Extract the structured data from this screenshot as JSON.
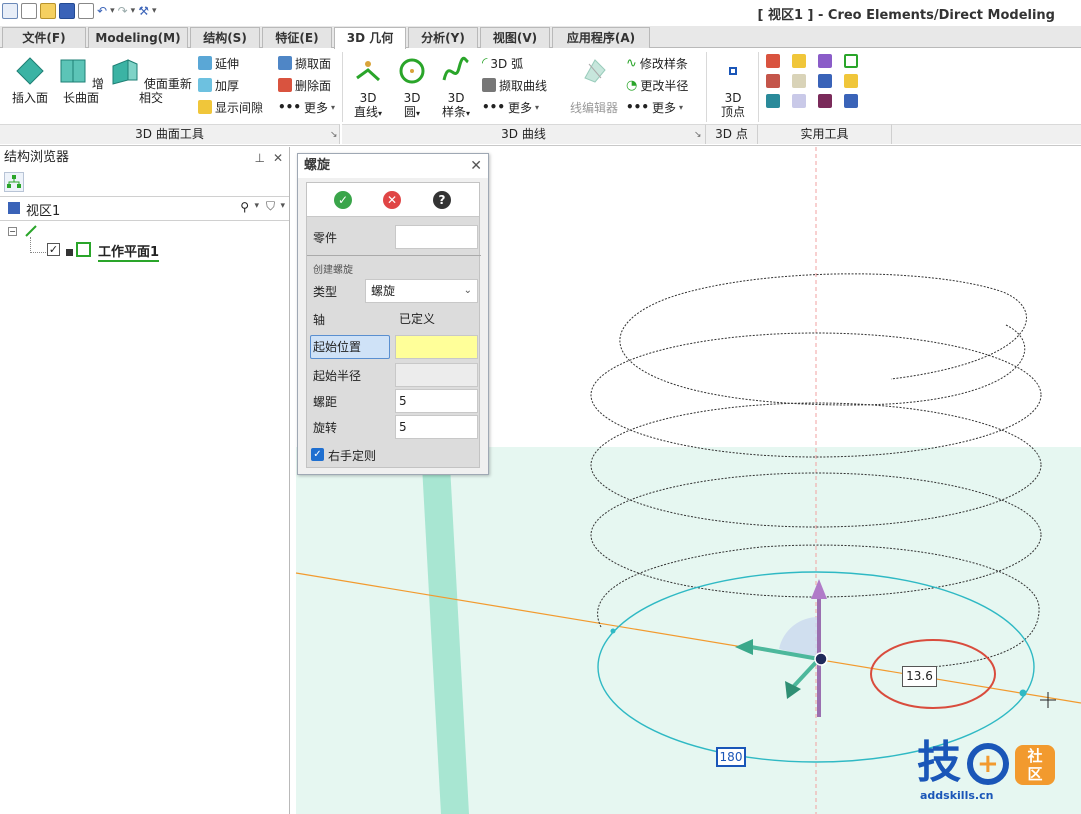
{
  "window": {
    "title": "[ 视区1 ] - Creo Elements/Direct Modeling"
  },
  "tabs": [
    {
      "label": "文件(F)"
    },
    {
      "label": "Modeling(M)"
    },
    {
      "label": "结构(S)"
    },
    {
      "label": "特征(E)"
    },
    {
      "label": "3D 几何"
    },
    {
      "label": "分析(Y)"
    },
    {
      "label": "视图(V)"
    },
    {
      "label": "应用程序(A)"
    }
  ],
  "ribbon": {
    "surface_tools": {
      "label": "3D 曲面工具",
      "insert_face": "插入面",
      "grow_surface": "增长曲面",
      "reintersect": "使面重新相交",
      "extend": "延伸",
      "thicken": "加厚",
      "show_gap": "显示间隙",
      "pick_face": "撷取面",
      "delete_face": "删除面",
      "more": "更多"
    },
    "curves": {
      "label": "3D 曲线",
      "line_top": "3D",
      "line_bottom": "直线",
      "circle_top": "3D",
      "circle_bottom": "圆",
      "spline_top": "3D",
      "spline_bottom": "样条",
      "arc": "3D 弧",
      "pick_curve": "撷取曲线",
      "more": "更多",
      "wire_editor": "线编辑器",
      "modify_spline": "修改样条",
      "change_radius": "更改半径",
      "more2": "更多"
    },
    "points": {
      "label": "3D 点",
      "vertex_top": "3D",
      "vertex_bottom": "顶点"
    },
    "utilities": {
      "label": "实用工具"
    }
  },
  "browser": {
    "title": "结构浏览器",
    "view_name": "视区1",
    "tree_item": "工作平面1"
  },
  "dialog": {
    "title": "螺旋",
    "part_label": "零件",
    "part_value": "",
    "section_label": "创建螺旋",
    "type_label": "类型",
    "type_value": "螺旋",
    "axis_label": "轴",
    "axis_value": "已定义",
    "start_pos_label": "起始位置",
    "start_pos_value": "",
    "start_radius_label": "起始半径",
    "start_radius_value": "",
    "pitch_label": "螺距",
    "pitch_value": "5",
    "turns_label": "旋转",
    "turns_value": "5",
    "right_hand_label": "右手定则",
    "right_hand_checked": true
  },
  "viewport": {
    "radius_readout": "13.6",
    "angle_readout": "180"
  },
  "watermark": {
    "text": "addskills.cn",
    "logo": "技社区"
  },
  "colors": {
    "accent_blue": "#1a56b8",
    "surface_green": "#b8ebd8",
    "circle_cyan": "#2fb9c4",
    "axis_orange": "#f29a2e",
    "highlight_yellow": "#ffff99",
    "annotation_red": "#d94c3d"
  }
}
